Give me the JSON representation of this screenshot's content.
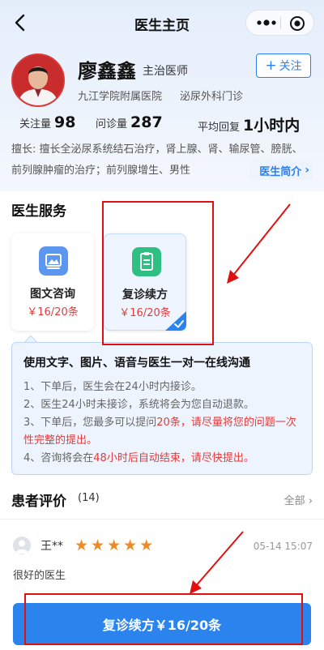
{
  "nav": {
    "title": "医生主页"
  },
  "doctor": {
    "name": "廖鑫鑫",
    "title": "主治医师",
    "hospital": "九江学院附属医院",
    "department": "泌尿外科门诊",
    "follow_label": "关注",
    "stats": {
      "followers_label": "关注量",
      "followers_value": "98",
      "consults_label": "问诊量",
      "consults_value": "287",
      "reply_label": "平均回复",
      "reply_value": "1小时内"
    },
    "specialty": "擅长: 擅长全泌尿系统结石治疗，肾上腺、肾、输尿管、膀胱、前列腺肿瘤的治疗；前列腺增生、男性",
    "intro_label": "医生简介"
  },
  "services": {
    "title": "医生服务",
    "items": [
      {
        "name": "图文咨询",
        "price": "￥16/20条",
        "selected": false
      },
      {
        "name": "复诊续方",
        "price": "￥16/20条",
        "selected": true
      }
    ],
    "info": {
      "heading": "使用文字、图片、语音与医生一对一在线沟通",
      "item1": "1、下单后，医生会在24小时内接诊。",
      "item2": "2、医生24小时未接诊，系统将会为您自动退款。",
      "item3_a": "3、下单后，您最多可以提问",
      "item3_b": "20条，请尽量将您的问题一次性完整的提出。",
      "item4_a": "4、咨询将会在",
      "item4_b": "48小时后自动结束，请尽快提出。"
    }
  },
  "reviews": {
    "title": "患者评价",
    "count": "(14)",
    "all_label": "全部",
    "items": [
      {
        "user": "王**",
        "rating": 5,
        "time": "05-14 15:07",
        "text": "很好的医生"
      }
    ]
  },
  "bottom_button": {
    "label": "复诊续方￥16/20条"
  },
  "colors": {
    "accent": "#2b83ee",
    "price_red": "#e23b3b",
    "star": "#f08a24",
    "annotation": "#e01010"
  }
}
